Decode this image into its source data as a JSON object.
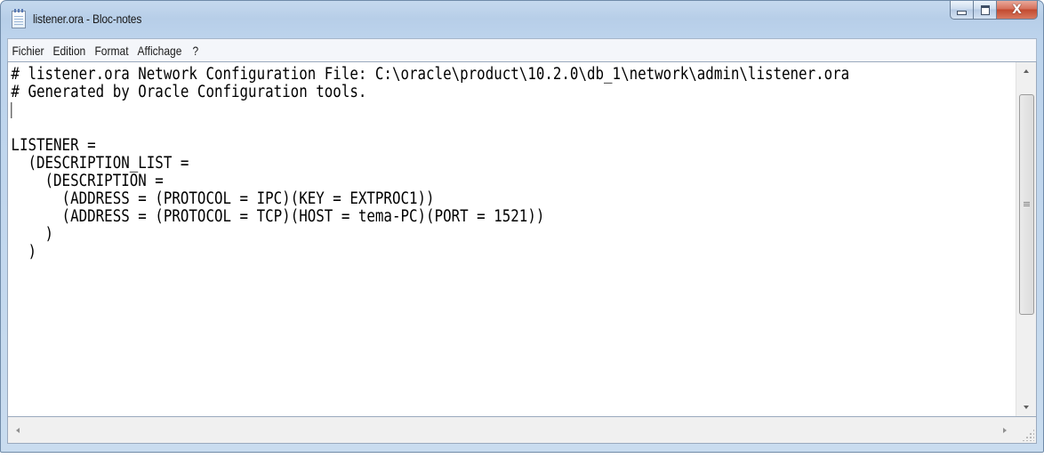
{
  "window": {
    "title": "listener.ora - Bloc-notes",
    "app_icon": "notepad-icon",
    "controls": {
      "minimize_icon": "minimize-icon",
      "maximize_icon": "maximize-icon",
      "close_icon": "close-icon",
      "close_glyph": "X"
    }
  },
  "menu": {
    "items": [
      {
        "label": "Fichier"
      },
      {
        "label": "Edition"
      },
      {
        "label": "Format"
      },
      {
        "label": "Affichage"
      },
      {
        "label": "?"
      }
    ]
  },
  "editor": {
    "lines": [
      "# listener.ora Network Configuration File: C:\\oracle\\product\\10.2.0\\db_1\\network\\admin\\listener.ora",
      "# Generated by Oracle Configuration tools.",
      "",
      "",
      "LISTENER =",
      "  (DESCRIPTION_LIST =",
      "    (DESCRIPTION =",
      "      (ADDRESS = (PROTOCOL = IPC)(KEY = EXTPROC1))",
      "      (ADDRESS = (PROTOCOL = TCP)(HOST = tema-PC)(PORT = 1521))",
      "    )",
      "  )",
      ""
    ]
  },
  "colors": {
    "titlebar": "#bcd3ec",
    "close_button": "#c24a2f",
    "editor_background": "#ffffff",
    "text": "#000000"
  }
}
